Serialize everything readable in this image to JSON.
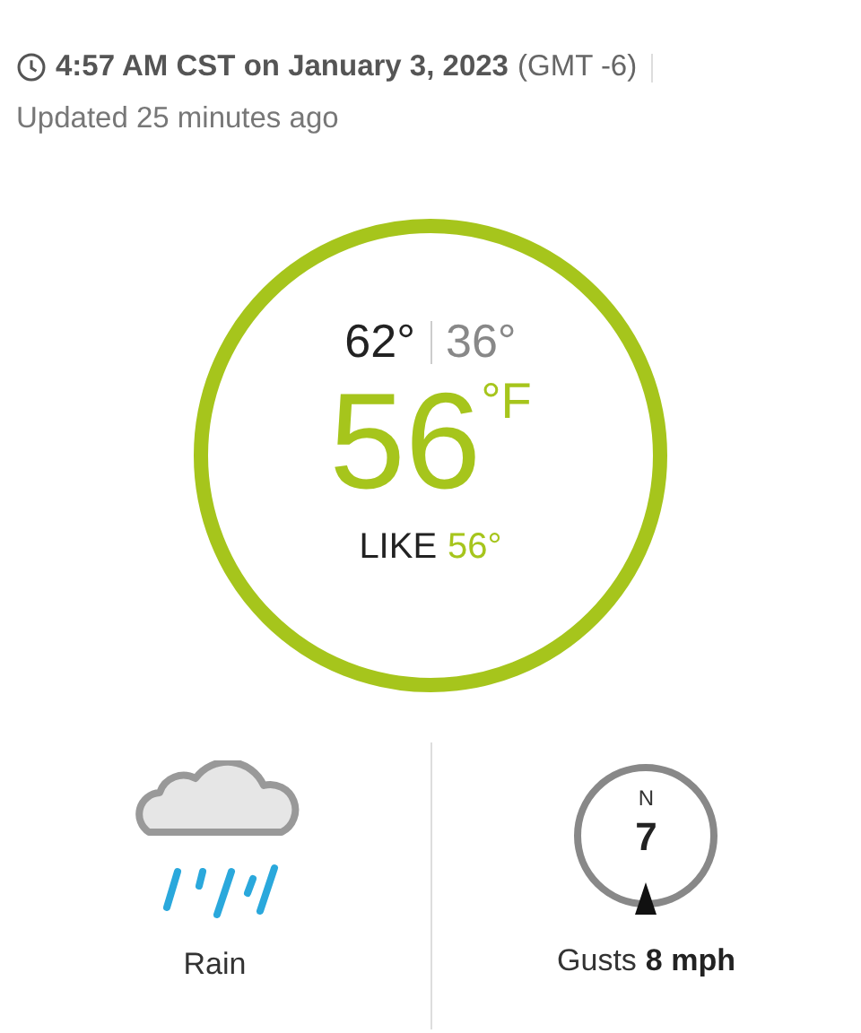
{
  "observation": {
    "time": "4:57 AM CST on January 3, 2023",
    "offset": "(GMT -6)",
    "updated": "Updated 25 minutes ago"
  },
  "temperature": {
    "high": "62°",
    "low": "36°",
    "current": "56",
    "unit": "°F",
    "feels_label": "LIKE",
    "feels_value": "56°"
  },
  "condition": {
    "kind": "rain",
    "label": "Rain"
  },
  "wind": {
    "direction": "N",
    "speed": "7",
    "gusts_label": "Gusts",
    "gusts_value": "8 mph"
  }
}
